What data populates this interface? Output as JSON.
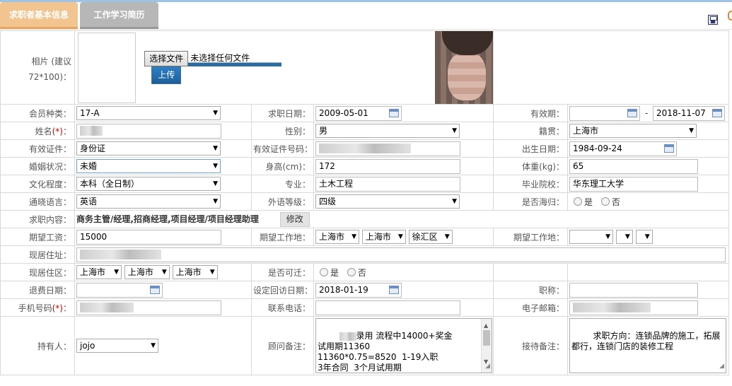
{
  "tabs": [
    {
      "label": "求职者基本信息"
    },
    {
      "label": "工作学习简历"
    }
  ],
  "photo": {
    "label": "相片 (建议72*100)：",
    "choose_button": "选择文件",
    "no_file_text": "未选择任何文件",
    "upload_button": "上传"
  },
  "fields": {
    "member_type": {
      "label": "会员种类：",
      "value": "17-A"
    },
    "job_date": {
      "label": "求职日期：",
      "value": "2009-05-01"
    },
    "valid_period": {
      "label": "有效期：",
      "from": "",
      "sep": "-",
      "to": "2018-11-07"
    },
    "name": {
      "label": "姓名",
      "req": "(*)",
      "colon": "："
    },
    "gender": {
      "label": "性别：",
      "value": "男"
    },
    "native_place": {
      "label": "籍贯：",
      "value": "上海市"
    },
    "id_type": {
      "label": "有效证件：",
      "value": "身份证"
    },
    "id_number": {
      "label": "有效证件号码："
    },
    "birth_date": {
      "label": "出生日期：",
      "value": "1984-09-24"
    },
    "marital": {
      "label": "婚姻状况：",
      "value": "未婚"
    },
    "height": {
      "label": "身高(cm)：",
      "value": "172"
    },
    "weight": {
      "label": "体重(kg)：",
      "value": "65"
    },
    "education": {
      "label": "文化程度：",
      "value": "本科（全日制）"
    },
    "major": {
      "label": "专业：",
      "value": "土木工程"
    },
    "school": {
      "label": "毕业院校：",
      "value": "华东理工大学"
    },
    "language": {
      "label": "通晓语言：",
      "value": "英语"
    },
    "language_level": {
      "label": "外语等级：",
      "value": "四级"
    },
    "returnee": {
      "label": "是否海归：",
      "yes": "是",
      "no": "否"
    },
    "job_content": {
      "label": "求职内容：",
      "value": "商务主管/经理,招商经理,项目经理/项目经理助理",
      "modify_button": "修改"
    },
    "expected_salary": {
      "label": "期望工资：",
      "value": "15000"
    },
    "expected_location1": {
      "label": "期望工作地：",
      "province": "上海市",
      "city": "上海市",
      "district": "徐汇区"
    },
    "expected_location2": {
      "label": "期望工作地："
    },
    "address": {
      "label": "现居住址："
    },
    "residence": {
      "label": "现居住区：",
      "province": "上海市",
      "city": "上海市",
      "district": "上海市"
    },
    "relocate": {
      "label": "是否可迁：",
      "yes": "是",
      "no": "否"
    },
    "refund_date": {
      "label": "退费日期："
    },
    "revisit_date": {
      "label": "设定回访日期：",
      "value": "2018-01-19"
    },
    "title": {
      "label": "职称："
    },
    "mobile": {
      "label": "手机号码",
      "req": "(*)",
      "colon": "："
    },
    "phone": {
      "label": "联系电话："
    },
    "email": {
      "label": "电子邮箱："
    },
    "owner": {
      "label": "持有人：",
      "value": "jojo"
    },
    "consultant_note": {
      "label": "顾问备注：",
      "value": "录用 流程中14000+奖金\n试用期11360\n11360*0.75=8520  1-19入职\n3年合同  3个月试用期"
    },
    "reception_note": {
      "label": "接待备注：",
      "value": "求职方向：连锁品牌的施工，拓展都行，连锁门店的装修工程"
    }
  },
  "icons": {
    "save": "save-icon",
    "calendar": "calendar-icon",
    "dropdown": "chevron-down-icon"
  },
  "colors": {
    "tab_active": "#f2c48f",
    "tab_inactive": "#b7b7b7",
    "upload_button": "#2f7fc4",
    "required": "#cc0000"
  }
}
